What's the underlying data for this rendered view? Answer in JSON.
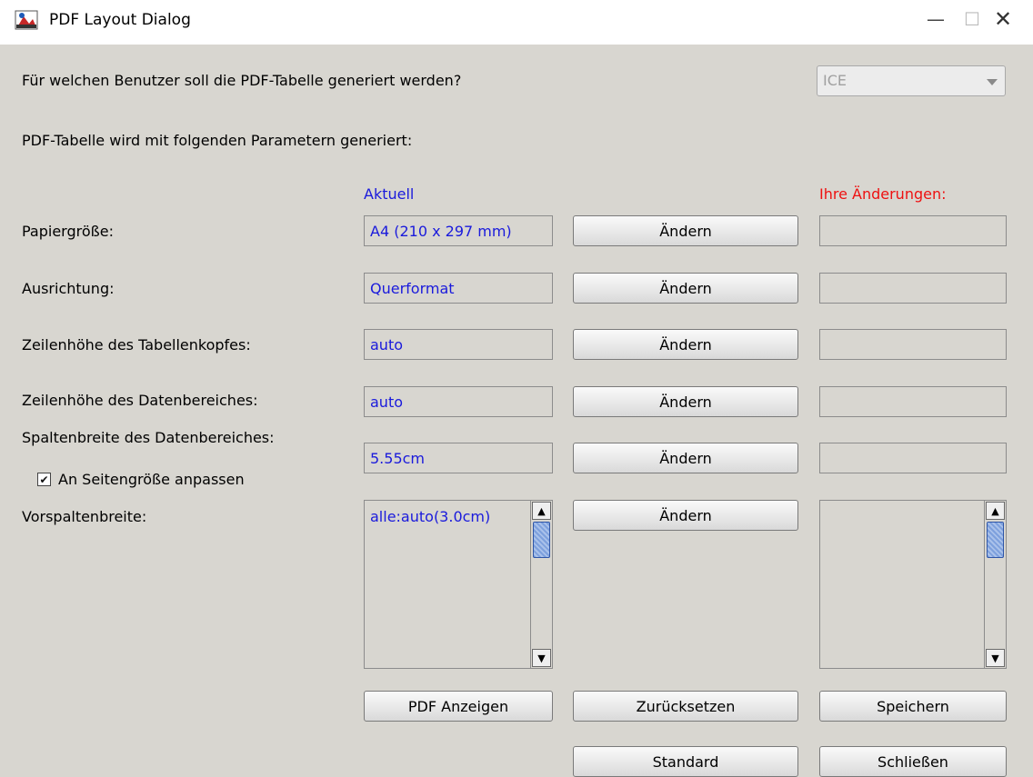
{
  "window": {
    "title": "PDF Layout Dialog",
    "minimize_glyph": "—",
    "maximize_glyph": "☐",
    "close_glyph": "✕"
  },
  "question": "Für welchen Benutzer soll die  PDF-Tabelle generiert werden?",
  "user_select": {
    "value": "ICE",
    "disabled": true
  },
  "params_heading": "PDF-Tabelle wird mit folgenden Parametern generiert:",
  "columns": {
    "current": "Aktuell",
    "changes": "Ihre Änderungen:"
  },
  "rows": [
    {
      "label": "Papiergröße:",
      "current": "A4 (210 x 297 mm)",
      "button": "Ändern",
      "change": ""
    },
    {
      "label": "Ausrichtung:",
      "current": "Querformat",
      "button": "Ändern",
      "change": ""
    },
    {
      "label": "Zeilenhöhe des Tabellenkopfes:",
      "current": "auto",
      "button": "Ändern",
      "change": ""
    },
    {
      "label": "Zeilenhöhe des Datenbereiches:",
      "current": "auto",
      "button": "Ändern",
      "change": ""
    },
    {
      "label": "Spaltenbreite des Datenbereiches:",
      "current": "5.55cm",
      "button": "Ändern",
      "change": ""
    },
    {
      "label": "Vorspaltenbreite:",
      "current": "alle:auto(3.0cm)",
      "button": "Ändern",
      "change": ""
    }
  ],
  "fit_checkbox": {
    "label": "An Seitengröße anpassen",
    "checked": true,
    "check_glyph": "✔"
  },
  "scroll_glyphs": {
    "up": "▲",
    "down": "▼"
  },
  "footer": {
    "pdf_anzeigen": "PDF Anzeigen",
    "zuruecksetzen": "Zurücksetzen",
    "speichern": "Speichern",
    "standard": "Standard",
    "schliessen": "Schließen"
  },
  "colors": {
    "current_text": "#1a1adc",
    "changes_header": "#ee1111",
    "dialog_bg": "#d8d6d0"
  }
}
